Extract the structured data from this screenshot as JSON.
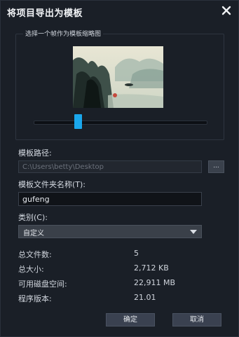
{
  "dialog": {
    "title": "将项目导出为模板"
  },
  "thumbnail_section": {
    "label": "选择一个帧作为模板缩略图",
    "slider_position": 0.22
  },
  "template_path": {
    "label": "模板路径:",
    "value": "C:\\Users\\betty\\Desktop",
    "browse_label": "..."
  },
  "folder_name": {
    "label": "模板文件夹名称(T):",
    "value": "gufeng"
  },
  "category": {
    "label": "类别(C):",
    "selected": "自定义"
  },
  "info": {
    "file_count_label": "总文件数:",
    "file_count": "5",
    "total_size_label": "总大小:",
    "total_size": "2,712 KB",
    "disk_space_label": "可用磁盘空间:",
    "disk_space": "22,911 MB",
    "version_label": "程序版本:",
    "version": "21.01"
  },
  "buttons": {
    "ok": "确定",
    "cancel": "取消"
  },
  "colors": {
    "accent": "#1aa7ec",
    "background": "#1a1f27"
  }
}
